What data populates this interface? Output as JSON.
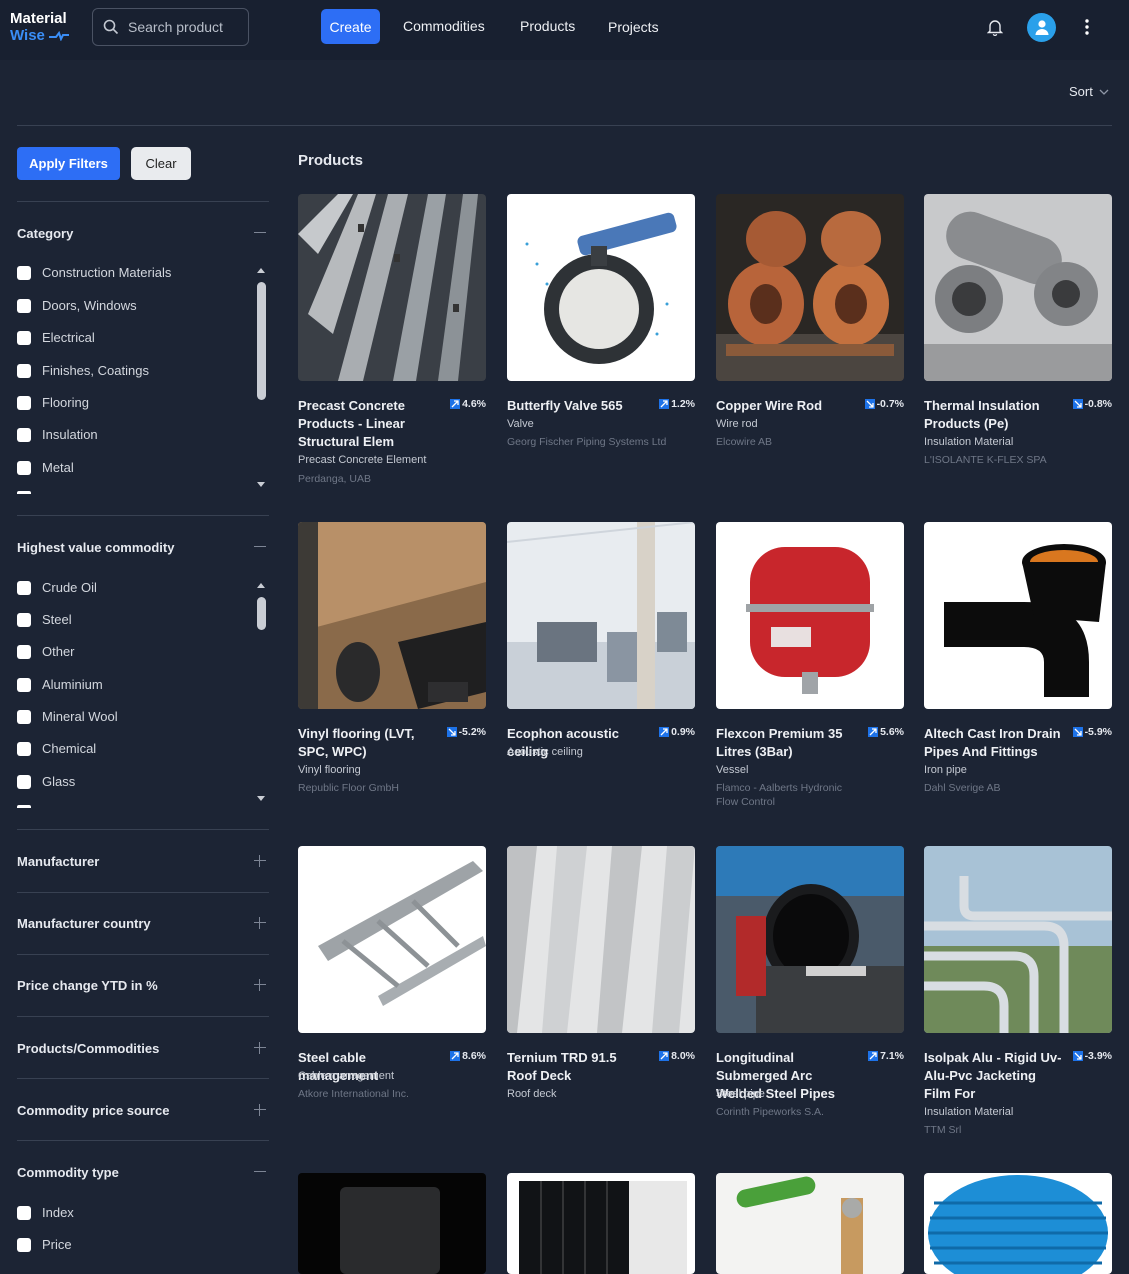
{
  "header": {
    "logo_line1": "Material",
    "logo_line2": "Wise",
    "search_placeholder": "Search product",
    "nav": {
      "create": "Create",
      "commodities": "Commodities",
      "products": "Products",
      "projects": "Projects"
    },
    "icons": {
      "bell": "bell-icon",
      "avatar": "user-icon",
      "menu": "more-vertical-icon"
    },
    "colors": {
      "accent": "#2d6ef5",
      "avatar": "#2aa0ea",
      "background": "#1c2434",
      "topbar": "#182030"
    }
  },
  "sort_label": "Sort",
  "filters": {
    "apply_label": "Apply Filters",
    "clear_label": "Clear",
    "category": {
      "title": "Category",
      "items": [
        "Construction Materials",
        "Doors, Windows",
        "Electrical",
        "Finishes, Coatings",
        "Flooring",
        "Insulation",
        "Metal"
      ]
    },
    "highest_value_commodity": {
      "title": "Highest value commodity",
      "items": [
        "Crude Oil",
        "Steel",
        "Other",
        "Aluminium",
        "Mineral Wool",
        "Chemical",
        "Glass"
      ]
    },
    "collapsed_sections": [
      "Manufacturer",
      "Manufacturer country",
      "Price change YTD in %",
      "Products/Commodities",
      "Commodity price source"
    ],
    "commodity_type": {
      "title": "Commodity type",
      "items": [
        "Index",
        "Price"
      ]
    }
  },
  "products_title": "Products",
  "products": [
    {
      "name": "Precast Concrete Products - Linear Structural Elem",
      "change": "4.6%",
      "trend": "up",
      "type": "Precast Concrete Element",
      "manufacturer": "Perdanga, UAB"
    },
    {
      "name": "Butterfly Valve 565",
      "change": "1.2%",
      "trend": "up",
      "type": "Valve",
      "manufacturer": "Georg Fischer Piping Systems Ltd"
    },
    {
      "name": "Copper Wire Rod",
      "change": "-0.7%",
      "trend": "down",
      "type": "Wire rod",
      "manufacturer": "Elcowire AB"
    },
    {
      "name": "Thermal Insulation Products (Pe)",
      "change": "-0.8%",
      "trend": "down",
      "type": "Insulation Material",
      "manufacturer": "L'ISOLANTE K-FLEX SPA"
    },
    {
      "name": "Vinyl flooring (LVT, SPC, WPC)",
      "change": "-5.2%",
      "trend": "down",
      "type": "Vinyl flooring",
      "manufacturer": "Republic Floor GmbH"
    },
    {
      "name": "Ecophon acoustic ceiling",
      "change": "0.9%",
      "trend": "up",
      "type": "Acoustic ceiling",
      "manufacturer": ""
    },
    {
      "name": "Flexcon Premium 35 Litres (3Bar)",
      "change": "5.6%",
      "trend": "up",
      "type": "Vessel",
      "manufacturer": "Flamco - Aalberts Hydronic Flow Control"
    },
    {
      "name": "Altech Cast Iron Drain Pipes And Fittings",
      "change": "-5.9%",
      "trend": "down",
      "type": "Iron pipe",
      "manufacturer": "Dahl Sverige AB"
    },
    {
      "name": "Steel cable management",
      "change": "8.6%",
      "trend": "up",
      "type": "Cable management",
      "manufacturer": "Atkore International Inc."
    },
    {
      "name": "Ternium TRD 91.5 Roof Deck",
      "change": "8.0%",
      "trend": "up",
      "type": "Roof deck",
      "manufacturer": ""
    },
    {
      "name": "Longitudinal Submerged Arc Welded Steel Pipes",
      "change": "7.1%",
      "trend": "up",
      "type": "Steel pipe",
      "manufacturer": "Corinth Pipeworks S.A."
    },
    {
      "name": "Isolpak Alu - Rigid Uv-Alu-Pvc Jacketing Film For",
      "change": "-3.9%",
      "trend": "down",
      "type": "Insulation Material",
      "manufacturer": "TTM Srl"
    },
    {
      "name": "",
      "change": "",
      "trend": "",
      "type": "",
      "manufacturer": ""
    },
    {
      "name": "",
      "change": "",
      "trend": "",
      "type": "",
      "manufacturer": ""
    },
    {
      "name": "",
      "change": "",
      "trend": "",
      "type": "",
      "manufacturer": ""
    },
    {
      "name": "",
      "change": "",
      "trend": "",
      "type": "",
      "manufacturer": ""
    }
  ]
}
